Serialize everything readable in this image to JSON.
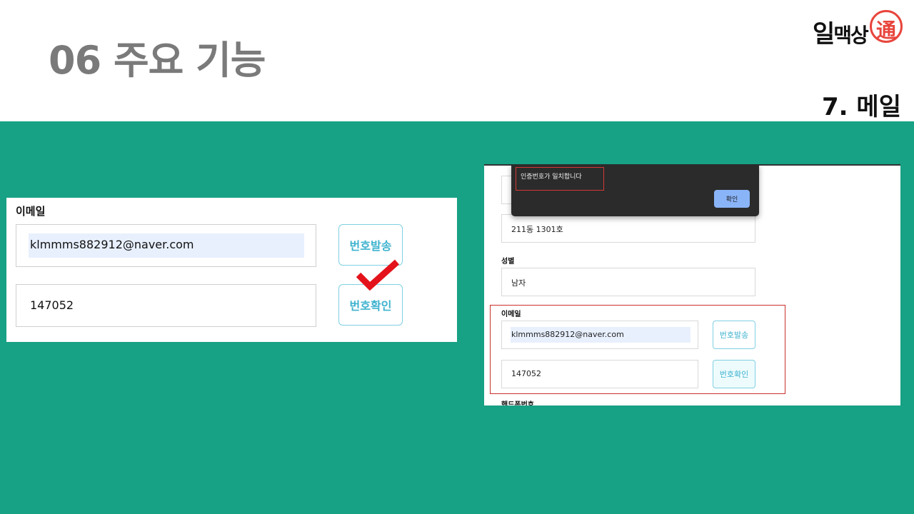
{
  "header": {
    "title": "06 주요 기능",
    "subtitle": "7. 메일",
    "logo": {
      "text_main": "일",
      "text_rest": "맥상",
      "seal_char": "通"
    }
  },
  "zoom": {
    "label": "이메일",
    "email_value": "klmmms882912@naver.com",
    "code_value": "147052",
    "send_button": "번호발송",
    "confirm_button": "번호확인",
    "check_color": "#e4131b"
  },
  "screenshot": {
    "dialog": {
      "message": "인증번호가 일치합니다",
      "ok_label": "확인"
    },
    "address_value": "211동 1301호",
    "gender_label": "성별",
    "gender_value": "남자",
    "email_label": "이메일",
    "email_value": "klmmms882912@naver.com",
    "code_value": "147052",
    "send_button": "번호발송",
    "confirm_button": "번호확인",
    "phone_label": "핸드폰번호"
  },
  "colors": {
    "band": "#17a185",
    "title_gray": "#7a7a7a",
    "accent_cyan": "#3fb3cf",
    "highlight_red": "#c9302c"
  }
}
